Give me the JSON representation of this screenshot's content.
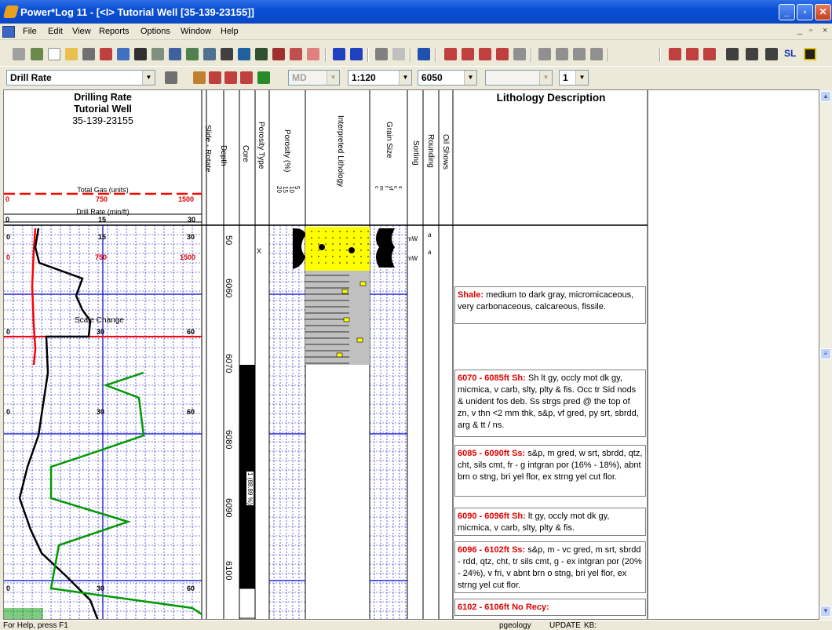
{
  "window": {
    "title": "Power*Log 11 - [<I> Tutorial Well [35-139-23155]]",
    "controls": [
      "_",
      "▫",
      "✕"
    ]
  },
  "menu": {
    "items": [
      "File",
      "Edit",
      "View",
      "Reports",
      "Options",
      "Window",
      "Help"
    ],
    "mdi_controls": [
      "_",
      "▫",
      "×"
    ]
  },
  "toolbar2": {
    "view_select": "Drill Rate",
    "md_select": "MD",
    "scale_select": "1:120",
    "depth_select": "6050",
    "blank_select": "",
    "track_select": "1",
    "sl_label": "SL"
  },
  "header": {
    "drill_title": "Drilling Rate",
    "well_name": "Tutorial Well",
    "well_id": "35-139-23155",
    "total_gas_label": "Total Gas (units)",
    "drill_rate_label": "Drill Rate (min/ft)",
    "gas_scale": [
      "0",
      "750",
      "1500"
    ],
    "rate_scale": [
      "0",
      "15",
      "30"
    ],
    "columns": {
      "slide_rotate": "Slide - Rotate",
      "depth": "Depth",
      "core": "Core",
      "porosity_type": "Porosity Type",
      "porosity": "Porosity (%)",
      "interpreted_lithology": "Interpreted Lithology",
      "grain_size": "Grain Size",
      "sorting": "Sorting",
      "rounding": "Rounding",
      "oil_shows": "Oil Shows",
      "lithology_description": "Lithology Description"
    },
    "porosity_scale": [
      "5",
      "10",
      "15",
      "20"
    ],
    "grain_scale": [
      "c",
      "m",
      "f",
      "vf",
      "c",
      "s",
      "sit"
    ]
  },
  "track": {
    "scale_rows": [
      {
        "left": "0",
        "mid": "15",
        "right": "30"
      },
      {
        "left": "0",
        "mid": "750",
        "right": "1500"
      },
      {
        "left": "0",
        "mid": "30",
        "right": "60"
      },
      {
        "left": "0",
        "mid": "30",
        "right": "60"
      },
      {
        "left": "0",
        "mid": "30",
        "right": "60"
      }
    ],
    "scale_change_label": "Scale Change",
    "depths": [
      "50",
      "6060",
      "6070",
      "6080",
      "6090",
      "6100"
    ],
    "core_label": "1 (88.89 %)",
    "porosity_type_mark": "X",
    "sorting_marks": [
      "mW",
      "mW"
    ],
    "rounding_marks": [
      "a",
      "a"
    ]
  },
  "descriptions": [
    {
      "heading": "Shale:",
      "text": " medium to dark gray, micromicaceous, very carbonaceous, calcareous, fissile."
    },
    {
      "heading": "6070 - 6085ft Sh:",
      "text": " Sh lt gy, occly mot dk gy, micmica, v carb, slty, plty & fis. Occ tr Sid nods & unident fos deb. Ss strgs pred @ the top of zn, v thn <2 mm thk, s&p, vf gred, py srt, sbrdd, arg & tt / ns."
    },
    {
      "heading": "6085 - 6090ft Ss:",
      "text": " s&p, m gred, w srt, sbrdd, qtz, cht, sils cmt, fr - g intgran por (16% - 18%), abnt brn o stng, bri yel flor, ex strng yel cut flor."
    },
    {
      "heading": "6090 - 6096ft Sh:",
      "text": " lt gy, occly mot dk gy, micmica, v carb, slty, plty & fis."
    },
    {
      "heading": "6096 - 6102ft Ss:",
      "text": " s&p, m - vc gred, m srt, sbrdd - rdd, qtz, cht, tr sils cmt, g - ex intgran por (20% - 24%), v fri, v abnt brn o stng, bri yel flor, ex strng yel cut flor."
    },
    {
      "heading": "6102 - 6106ft No Recy:",
      "text": ""
    }
  ],
  "status": {
    "help": "For Help, press F1",
    "user": "pgeology",
    "mode": "UPDATE",
    "kb": "KB:"
  },
  "colors": {
    "gas_line": "#ff0000",
    "rate_line": "#000000",
    "second_rate_line": "#009900",
    "sand_fill": "#ffff00",
    "shale_fill": "#c0c0c0",
    "description_heading": "#e00000",
    "grid_major": "#0000cc"
  }
}
